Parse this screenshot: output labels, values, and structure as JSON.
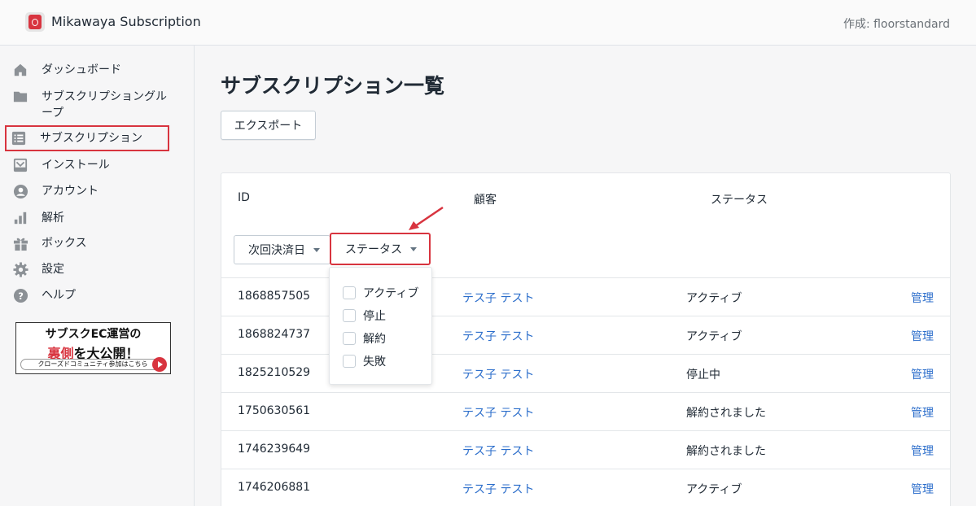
{
  "header": {
    "app_name": "Mikawaya Subscription",
    "author": "作成: floorstandard"
  },
  "sidebar": {
    "items": [
      {
        "label": "ダッシュボード",
        "icon": "home-icon"
      },
      {
        "label": "サブスクリプショングループ",
        "icon": "folder-icon"
      },
      {
        "label": "サブスクリプション",
        "icon": "list-icon",
        "active": true
      },
      {
        "label": "インストール",
        "icon": "inbox-icon"
      },
      {
        "label": "アカウント",
        "icon": "user-icon"
      },
      {
        "label": "解析",
        "icon": "analytics-icon"
      },
      {
        "label": "ボックス",
        "icon": "gift-icon"
      },
      {
        "label": "設定",
        "icon": "gear-icon"
      },
      {
        "label": "ヘルプ",
        "icon": "help-icon"
      }
    ],
    "banner": {
      "line1": "サブスクEC運営の",
      "line2_red": "裏側",
      "line2_rest": "を大公開！",
      "line3": "クローズドコミュニティ参加はこちら"
    }
  },
  "main": {
    "title": "サブスクリプション一覧",
    "export_label": "エクスポート",
    "columns": {
      "id": "ID",
      "customer": "顧客",
      "status": "ステータス"
    },
    "filters": {
      "next_payment": "次回決済日",
      "status": "ステータス"
    },
    "status_options": [
      "アクティブ",
      "停止",
      "解約",
      "失敗"
    ],
    "rows": [
      {
        "id": "1868857505",
        "customer": "テス子 テスト",
        "status": "アクティブ",
        "action": "管理"
      },
      {
        "id": "1868824737",
        "customer": "テス子 テスト",
        "status": "アクティブ",
        "action": "管理"
      },
      {
        "id": "1825210529",
        "customer": "テス子 テスト",
        "status": "停止中",
        "action": "管理"
      },
      {
        "id": "1750630561",
        "customer": "テス子 テスト",
        "status": "解約されました",
        "action": "管理"
      },
      {
        "id": "1746239649",
        "customer": "テス子 テスト",
        "status": "解約されました",
        "action": "管理"
      },
      {
        "id": "1746206881",
        "customer": "テス子 テスト",
        "status": "アクティブ",
        "action": "管理"
      }
    ]
  },
  "colors": {
    "accent_red": "#d8343f",
    "link_blue": "#2c6ecb",
    "icon_gray": "#8c9196"
  }
}
